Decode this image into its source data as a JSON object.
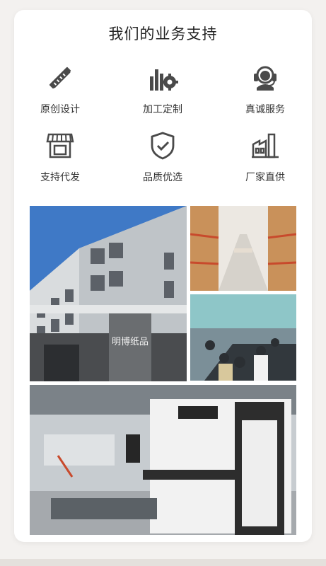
{
  "section": {
    "title": "我们的业务支持"
  },
  "services": [
    {
      "label": "原创设计",
      "icon": "design-pencil-ruler-icon"
    },
    {
      "label": "加工定制",
      "icon": "factory-gear-icon"
    },
    {
      "label": "真诚服务",
      "icon": "customer-service-headset-icon"
    },
    {
      "label": "支持代发",
      "icon": "storefront-icon"
    },
    {
      "label": "品质优选",
      "icon": "quality-shield-check-icon"
    },
    {
      "label": "厂家直供",
      "icon": "factory-building-icon"
    }
  ],
  "photos": {
    "building_sign": "明博纸品",
    "building": "company-building-photo",
    "warehouse": "warehouse-shelves-photo",
    "meeting": "team-meeting-photo",
    "machine": "die-cutting-machine-photo"
  },
  "colors": {
    "icon": "#4a4a4a",
    "shelf_red": "#c84a2c",
    "sky": "#3f79c6"
  }
}
